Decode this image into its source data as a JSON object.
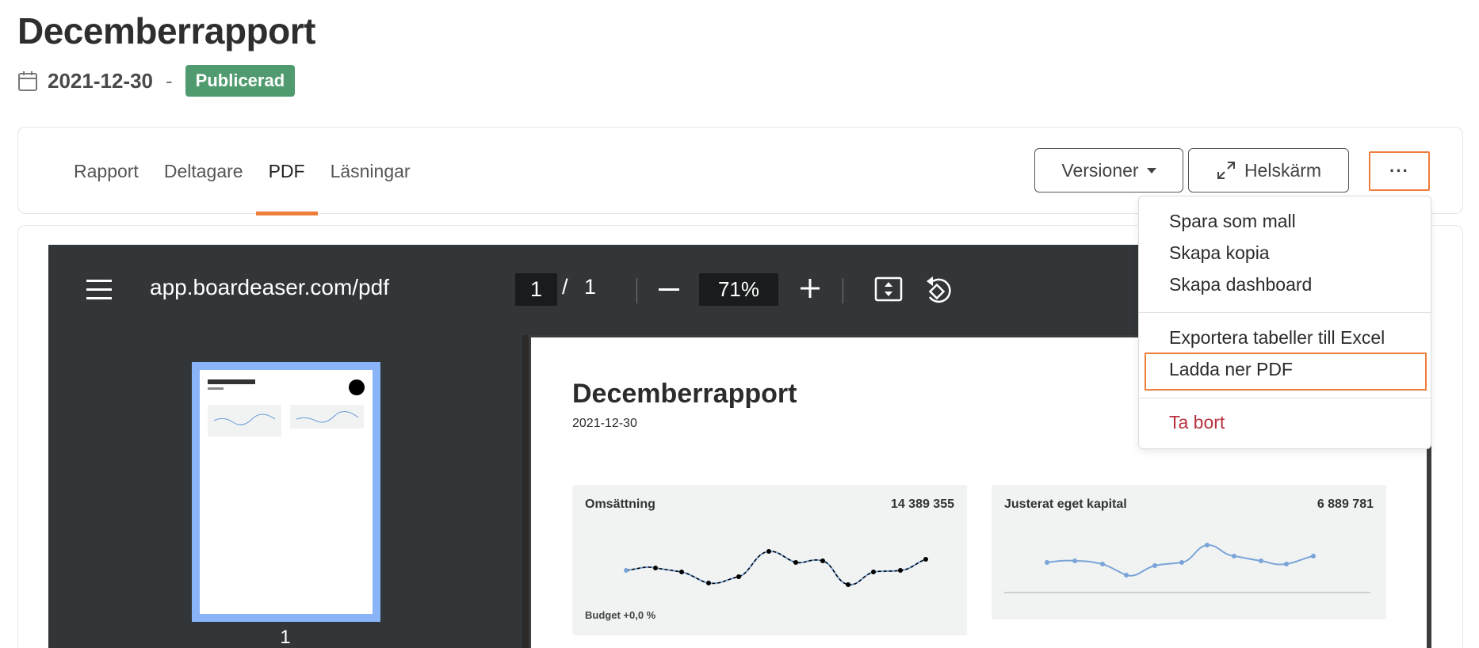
{
  "header": {
    "title": "Decemberrapport",
    "date": "2021-12-30",
    "separator": "-",
    "status_badge": "Publicerad"
  },
  "tabs": [
    {
      "label": "Rapport",
      "active": false
    },
    {
      "label": "Deltagare",
      "active": false
    },
    {
      "label": "PDF",
      "active": true
    },
    {
      "label": "Läsningar",
      "active": false
    }
  ],
  "toolbar": {
    "versions_label": "Versioner",
    "fullscreen_label": "Helskärm",
    "more_label": "···"
  },
  "menu": {
    "items": [
      {
        "label": "Spara som mall"
      },
      {
        "label": "Skapa kopia"
      },
      {
        "label": "Skapa dashboard"
      },
      {
        "label": "Exportera tabeller till Excel"
      },
      {
        "label": "Ladda ner PDF"
      },
      {
        "label": "Ta bort"
      }
    ]
  },
  "viewer": {
    "url": "app.boardeaser.com/pdf",
    "current_page": "1",
    "page_separator": "/",
    "total_pages": "1",
    "zoom": "71%",
    "thumbnail_number": "1"
  },
  "pdf": {
    "title": "Decemberrapport",
    "date": "2021-12-30",
    "kpis": [
      {
        "label": "Omsättning",
        "value": "14 389 355",
        "footer": "Budget +0,0 %"
      },
      {
        "label": "Justerat eget kapital",
        "value": "6 889 781",
        "footer": ""
      }
    ]
  },
  "colors": {
    "accent": "#ef7d3c",
    "badge": "#4f9a6e",
    "danger": "#b8323f",
    "viewer_bg": "#323639"
  }
}
